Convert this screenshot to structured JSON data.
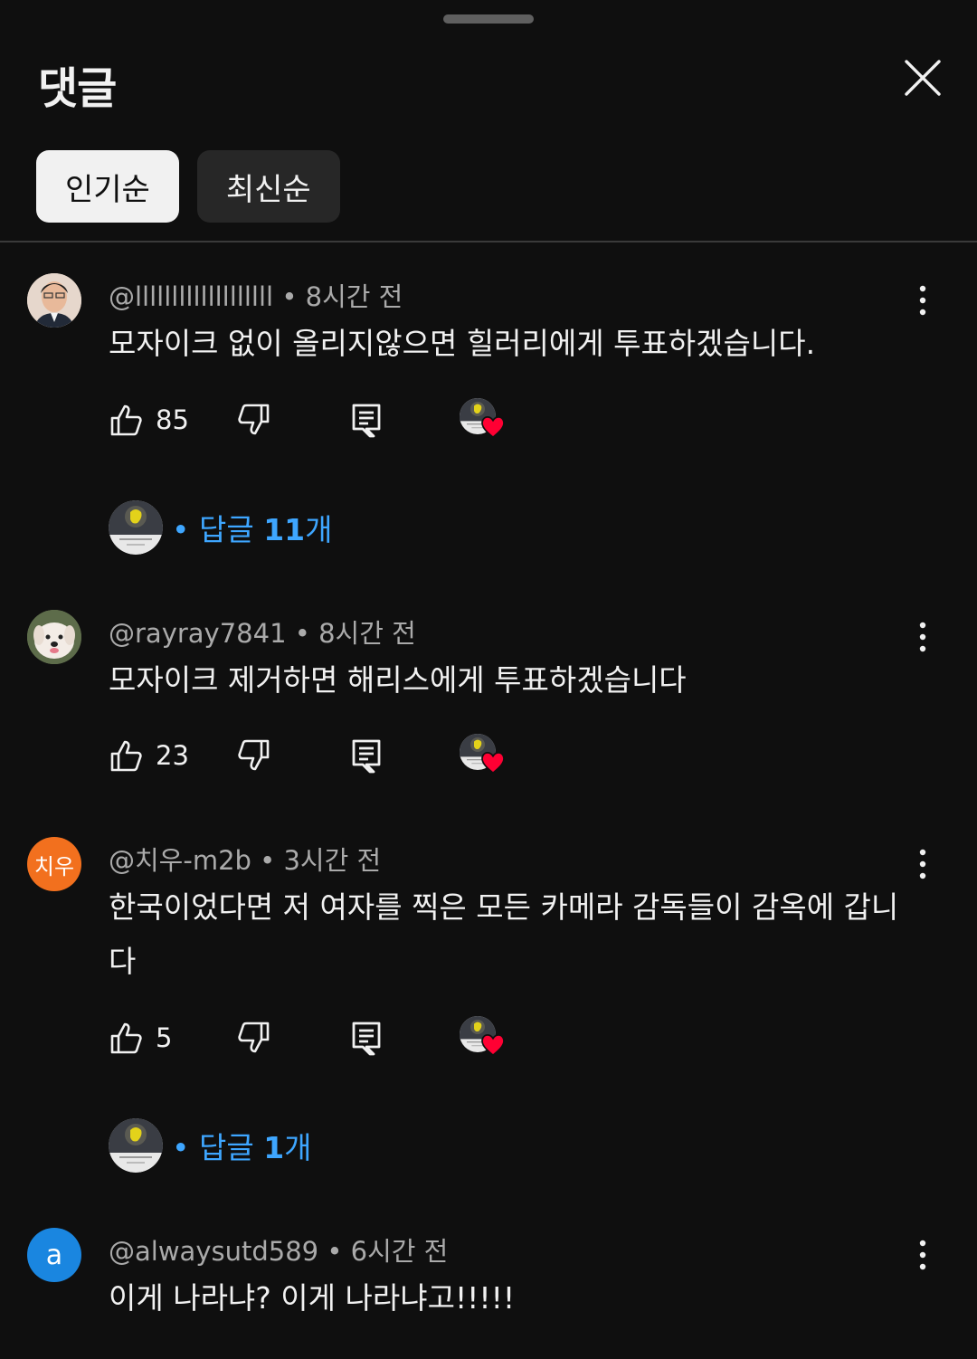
{
  "header": {
    "title": "댓글"
  },
  "sort_chips": [
    {
      "label": "인기순",
      "active": true
    },
    {
      "label": "최신순",
      "active": false
    }
  ],
  "comments": [
    {
      "author": "@lllllllllllllllllll",
      "time": "8시간 전",
      "text": "모자이크 없이 올리지않으면 힐러리에게 투표하겠습니다.",
      "likes": "85",
      "avatar": {
        "type": "photo-man",
        "bg": "#d8c2b0"
      },
      "replies_prefix": "답글 ",
      "replies_count": "11",
      "replies_suffix": "개"
    },
    {
      "author": "@rayray7841",
      "time": "8시간 전",
      "text": "모자이크 제거하면 해리스에게 투표하겠습니다",
      "likes": "23",
      "avatar": {
        "type": "photo-dog",
        "bg": "#6b7a56"
      }
    },
    {
      "author": "@치우-m2b",
      "time": "3시간 전",
      "text": "한국이었다면 저 여자를 찍은 모든 카메라 감독들이 감옥에 갑니다",
      "likes": "5",
      "avatar": {
        "type": "initials",
        "initials": "치우",
        "bg": "#f2701e"
      },
      "replies_prefix": "답글 ",
      "replies_count": "1",
      "replies_suffix": "개"
    },
    {
      "author": "@alwaysutd589",
      "time": "6시간 전",
      "text": "이게 나라냐? 이게 나라냐고!!!!!",
      "avatar": {
        "type": "initials",
        "initials": "a",
        "bg": "#1a86e0"
      }
    }
  ],
  "colors": {
    "background": "#0f0f0f",
    "link": "#3ea6ff",
    "heart": "#ff0033",
    "meta": "#aaaaaa"
  },
  "icons": [
    "close-icon",
    "kebab-menu-icon",
    "thumbs-up-icon",
    "thumbs-down-icon",
    "reply-icon",
    "creator-heart-icon"
  ]
}
